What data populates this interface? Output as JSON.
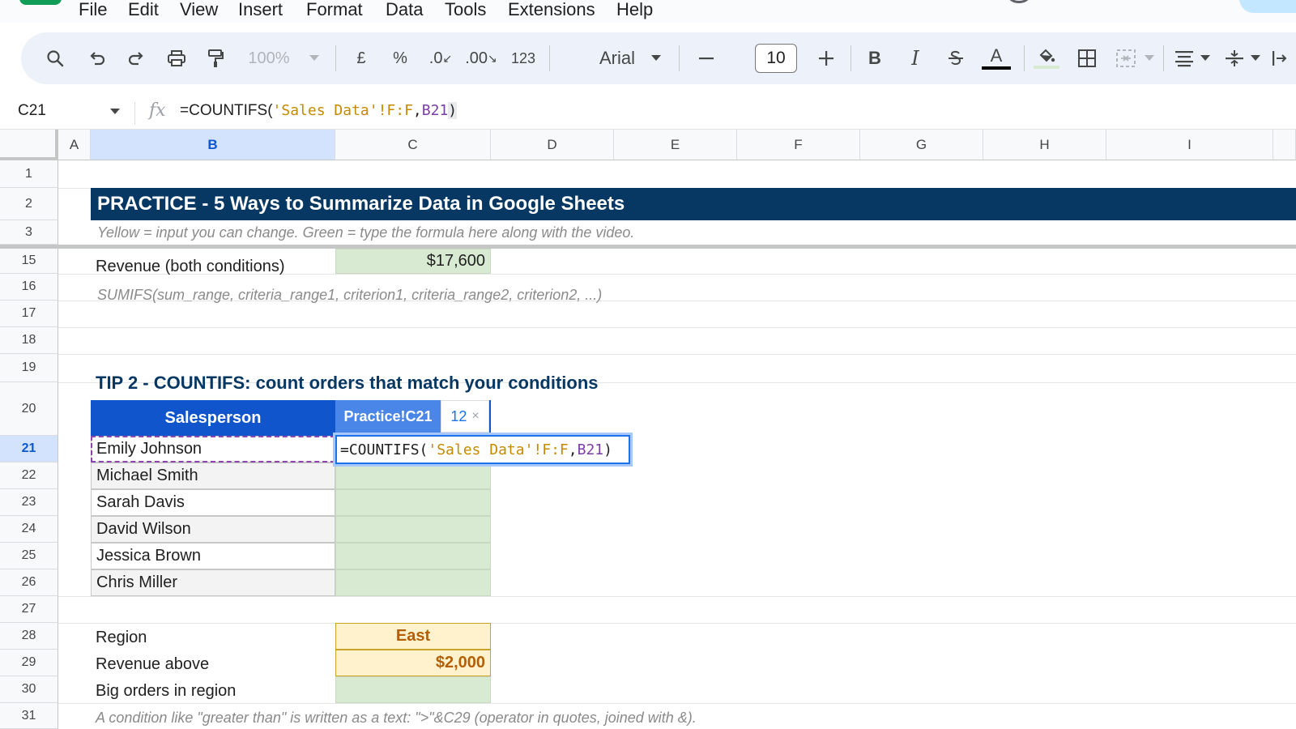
{
  "menu": [
    "File",
    "Edit",
    "View",
    "Insert",
    "Format",
    "Data",
    "Tools",
    "Extensions",
    "Help"
  ],
  "toolbar": {
    "zoom": "100%",
    "currency": "£",
    "percent": "%",
    "decrease_decimal": ".0",
    "increase_decimal": ".00",
    "number_format": "123",
    "font": "Arial",
    "font_size": "10",
    "bold": "B",
    "italic": "I",
    "text_color_letter": "A"
  },
  "formula_bar": {
    "name_box": "C21",
    "fx": "fx",
    "formula_prefix": "=COUNTIFS(",
    "formula_string": "'Sales Data'!F:F",
    "formula_comma": ",",
    "formula_ref": "B21",
    "formula_close": ")"
  },
  "columns": [
    "A",
    "B",
    "C",
    "D",
    "E",
    "F",
    "G",
    "H",
    "I"
  ],
  "rows": [
    "1",
    "2",
    "3",
    "15",
    "16",
    "17",
    "18",
    "19",
    "20",
    "21",
    "22",
    "23",
    "24",
    "25",
    "26",
    "27",
    "28",
    "29",
    "30",
    "31"
  ],
  "sheet": {
    "banner": "PRACTICE  -  5 Ways to Summarize Data in Google Sheets",
    "legend": "Yellow = input you can change.  Green = type the formula here along with the video.",
    "revenue_both_label": "Revenue (both conditions)",
    "revenue_both_value": "$17,600",
    "sumifs_syntax": "SUMIFS(sum_range, criteria_range1, criterion1, criteria_range2, criterion2, ...)",
    "tip2_title": "TIP 2  -  COUNTIFS: count orders that match your conditions",
    "salesperson_header": "Salesperson",
    "salespeople": [
      "Emily Johnson",
      "Michael Smith",
      "Sarah Davis",
      "David Wilson",
      "Jessica Brown",
      "Chris Miller"
    ],
    "region_label": "Region",
    "region_value": "East",
    "revenue_above_label": "Revenue above",
    "revenue_above_value": "$2,000",
    "big_orders_label": "Big orders in region",
    "condition_note": "A condition like \"greater than\" is written as a text: \">\"&C29  (operator in quotes, joined with &)."
  },
  "tooltip": {
    "ref": "Practice!C21",
    "value": "12",
    "close": "×"
  },
  "colors": {
    "banner": "#073763",
    "header_blue": "#1155cc",
    "input_yellow": "#fff2cc",
    "formula_green": "#d9ead3",
    "accent": "#1a73e8"
  }
}
